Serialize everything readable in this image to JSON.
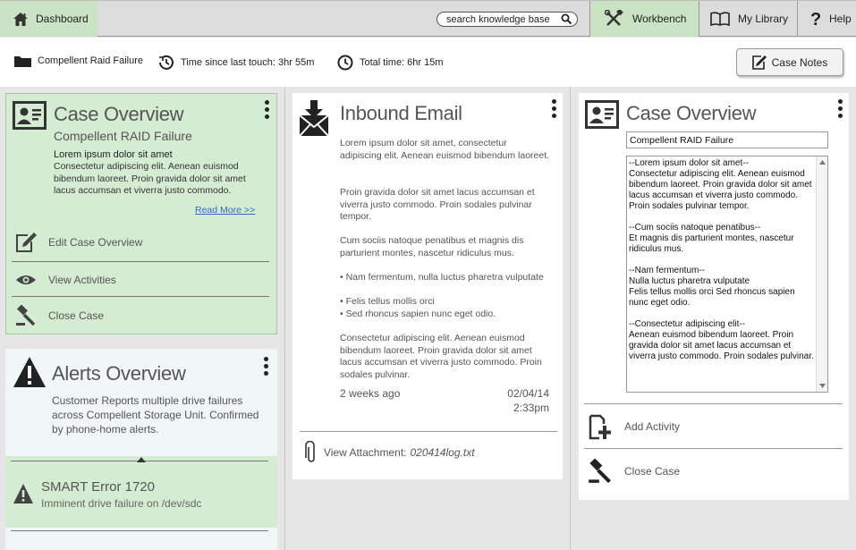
{
  "topbar": {
    "dashboard_label": "Dashboard",
    "search_placeholder": "search knowledge base",
    "workbench_label": "Workbench",
    "library_label": "My Library",
    "help_label": "Help"
  },
  "info": {
    "case_name": "Compellent Raid Failure",
    "time_since_touch": "Time since last touch: 3hr 55m",
    "total_time": "Total time: 6hr 15m",
    "case_notes_label": "Case Notes"
  },
  "left": {
    "overview": {
      "title": "Case Overview",
      "subtitle": "Compellent RAID Failure",
      "lead": "Lorem ipsum dolor sit amet",
      "body": "Consectetur adipiscing elit. Aenean euismod bibendum laoreet. Proin gravida dolor sit amet lacus accumsan et viverra justo commodo.",
      "read_more": "Read More >>",
      "actions": [
        "Edit Case Overview",
        "View Activities",
        "Close Case"
      ]
    },
    "alerts": {
      "title": "Alerts Overview",
      "body": "Customer Reports multiple drive failures across Compellent Storage Unit. Confirmed by phone-home alerts.",
      "item_title": "SMART Error 1720",
      "item_desc": "Imminent drive failure on /dev/sdc"
    }
  },
  "middle": {
    "title": "Inbound Email",
    "paragraphs": [
      "Lorem ipsum dolor sit amet, consectetur adipiscing elit. Aenean euismod bibendum laoreet.",
      "Proin gravida dolor sit amet lacus accumsan et viverra justo commodo. Proin sodales pulvinar tempor.",
      "Cum sociis natoque penatibus et magnis dis parturient montes, nascetur ridiculus mus."
    ],
    "bullets": [
      "Nam fermentum, nulla luctus pharetra vulputate",
      "Felis tellus mollis orci",
      "Sed rhoncus sapien nunc eget odio."
    ],
    "closing": "Consectetur adipiscing elit. Aenean euismod bibendum laoreet. Proin gravida dolor sit amet lacus accumsan et viverra justo commodo. Proin sodales pulvinar.",
    "age": "2 weeks ago",
    "date": "02/04/14",
    "time": "2:33pm",
    "attachment_label": "View Attachment:",
    "attachment_file": "020414log.txt"
  },
  "right": {
    "title": "Case Overview",
    "title_input": "Compellent RAID Failure",
    "notes_text": "--Lorem ipsum dolor sit amet--\nConsectetur adipiscing elit. Aenean euismod bibendum laoreet. Proin gravida dolor sit amet lacus accumsan et viverra justo commodo. Proin sodales pulvinar tempor.\n\n--Cum sociis natoque penatibus--\nEt magnis dis parturient montes, nascetur ridiculus mus.\n\n--Nam fermentum--\nNulla luctus pharetra vulputate\nFelis tellus mollis orci Sed rhoncus sapien nunc eget odio.\n\n--Consectetur adipiscing elit--\nAenean euismod bibendum laoreet. Proin gravida dolor sit amet lacus accumsan et viverra justo commodo. Proin sodales pulvinar.",
    "add_activity": "Add Activity",
    "close_case": "Close Case"
  },
  "colors": {
    "green_panel": "#d4ecd2",
    "topbar_active": "#c9e3c4",
    "link": "#3366cc"
  }
}
